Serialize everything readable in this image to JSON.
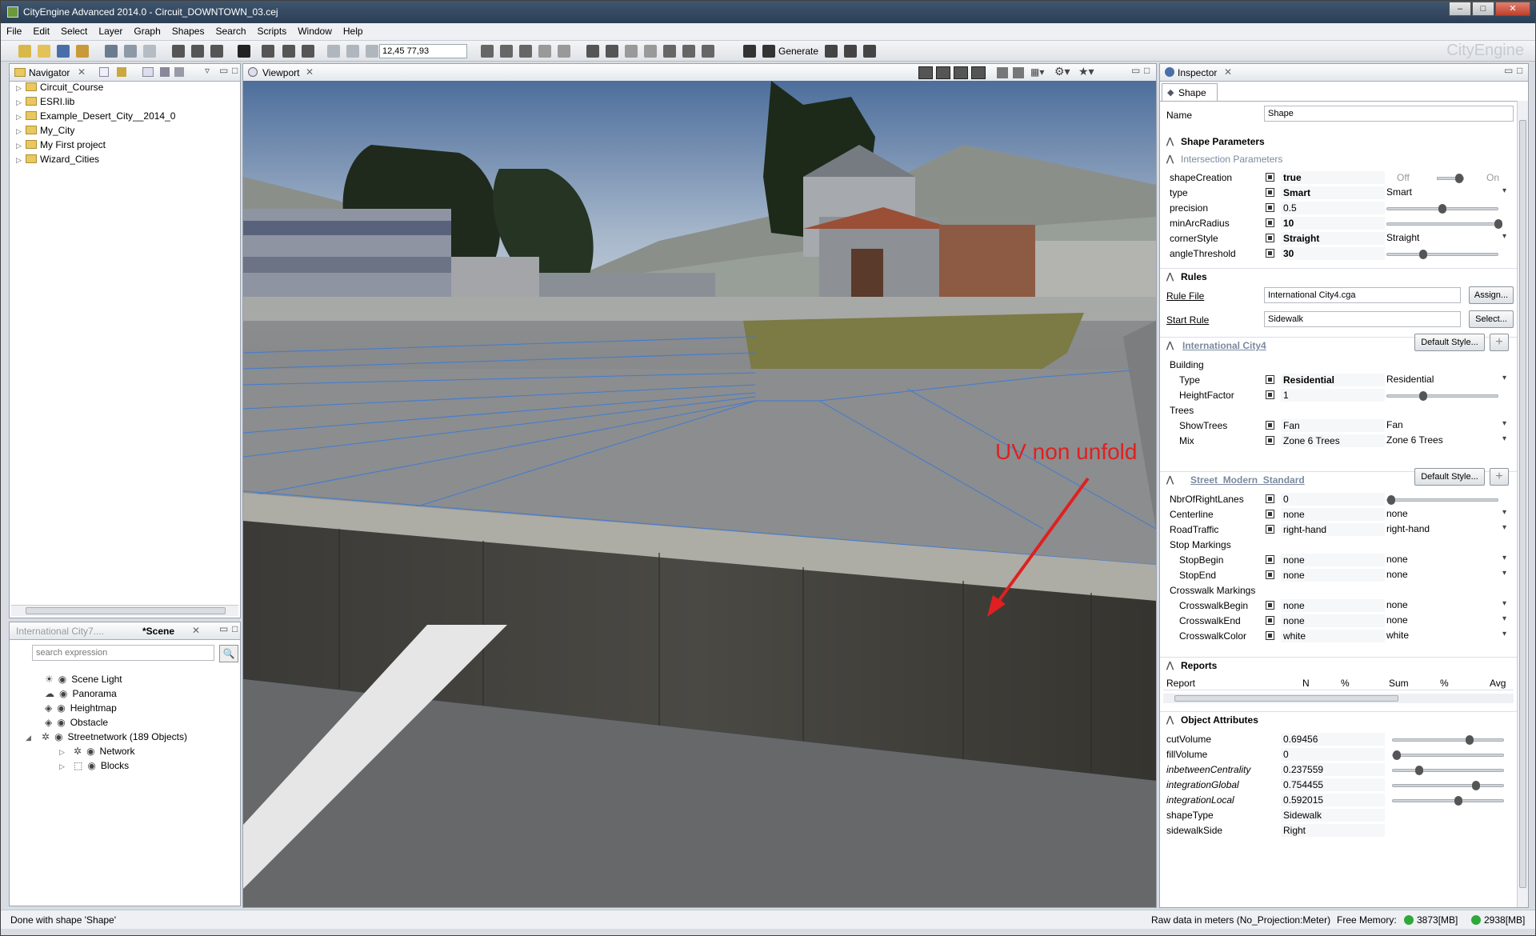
{
  "window": {
    "title": "CityEngine Advanced 2014.0 - Circuit_DOWNTOWN_03.cej"
  },
  "menu": [
    "File",
    "Edit",
    "Select",
    "Layer",
    "Graph",
    "Shapes",
    "Search",
    "Scripts",
    "Window",
    "Help"
  ],
  "toolbar": {
    "coord_value": "12,45 77,93",
    "generate_label": "Generate",
    "brand": "CityEngine"
  },
  "navigator": {
    "tab_label": "Navigator",
    "items": [
      "Circuit_Course",
      "ESRI.lib",
      "Example_Desert_City__2014_0",
      "My_City",
      "My First project",
      "Wizard_Cities"
    ]
  },
  "scene": {
    "tab_inactive": "International City7....",
    "tab_active": "*Scene",
    "search_placeholder": "search expression",
    "layers": [
      "Scene Light",
      "Panorama",
      "Heightmap",
      "Obstacle",
      "Streetnetwork (189 Objects)",
      "Network",
      "Blocks"
    ]
  },
  "viewport": {
    "tab_label": "Viewport",
    "annotation": "UV non unfold"
  },
  "inspector": {
    "tab_label": "Inspector",
    "subtab": "Shape",
    "name_label": "Name",
    "name_value": "Shape",
    "shape_parameters": "Shape Parameters",
    "intersection_parameters": "Intersection Parameters",
    "params": [
      {
        "label": "shapeCreation",
        "value": "true",
        "off": "Off",
        "on": "On"
      },
      {
        "label": "type",
        "value": "Smart",
        "choice": "Smart"
      },
      {
        "label": "precision",
        "value": "0.5",
        "slider": 0.5
      },
      {
        "label": "minArcRadius",
        "value": "10",
        "slider": 1.0
      },
      {
        "label": "cornerStyle",
        "value": "Straight",
        "choice": "Straight"
      },
      {
        "label": "angleThreshold",
        "value": "30",
        "slider": 0.33
      }
    ],
    "rules": {
      "title": "Rules",
      "rule_file_label": "Rule File",
      "rule_file_value": "International City4.cga",
      "assign": "Assign...",
      "start_rule_label": "Start Rule",
      "start_rule_value": "Sidewalk",
      "select": "Select..."
    },
    "city4": {
      "title": "International City4",
      "default_style": "Default Style...",
      "building": "Building",
      "type_label": "Type",
      "type_value": "Residential",
      "type_choice": "Residential",
      "height_label": "HeightFactor",
      "height_value": "1",
      "height_slider": 0.33,
      "trees": "Trees",
      "showtrees_label": "ShowTrees",
      "showtrees_value": "Fan",
      "showtrees_choice": "Fan",
      "mix_label": "Mix",
      "mix_value": "Zone 6 Trees",
      "mix_choice": "Zone 6 Trees"
    },
    "street": {
      "title": "Street_Modern_Standard",
      "default_style": "Default Style...",
      "rightlanes_label": "NbrOfRightLanes",
      "rightlanes_value": "0",
      "rightlanes_slider": 0.0,
      "centerline_label": "Centerline",
      "centerline_value": "none",
      "centerline_choice": "none",
      "traffic_label": "RoadTraffic",
      "traffic_value": "right-hand",
      "traffic_choice": "right-hand",
      "stop_markings": "Stop Markings",
      "stopbegin_label": "StopBegin",
      "stopbegin_value": "none",
      "stopbegin_choice": "none",
      "stopend_label": "StopEnd",
      "stopend_value": "none",
      "stopend_choice": "none",
      "crosswalk_markings": "Crosswalk Markings",
      "cwbegin_label": "CrosswalkBegin",
      "cwbegin_value": "none",
      "cwbegin_choice": "none",
      "cwend_label": "CrosswalkEnd",
      "cwend_value": "none",
      "cwend_choice": "none",
      "cwcolor_label": "CrosswalkColor",
      "cwcolor_value": "white",
      "cwcolor_choice": "white"
    },
    "reports": {
      "title": "Reports",
      "columns": [
        "Report",
        "N",
        "%",
        "Sum",
        "%",
        "Avg"
      ]
    },
    "object_attributes": {
      "title": "Object Attributes",
      "rows": [
        {
          "label": "cutVolume",
          "value": "0.69456",
          "slider": 0.69,
          "italic": false
        },
        {
          "label": "fillVolume",
          "value": "0",
          "slider": 0.0,
          "italic": false
        },
        {
          "label": "inbetweenCentrality",
          "value": "0.237559",
          "slider": 0.24,
          "italic": true
        },
        {
          "label": "integrationGlobal",
          "value": "0.754455",
          "slider": 0.75,
          "italic": true
        },
        {
          "label": "integrationLocal",
          "value": "0.592015",
          "slider": 0.59,
          "italic": true
        },
        {
          "label": "shapeType",
          "value": "Sidewalk",
          "italic": false
        },
        {
          "label": "sidewalkSide",
          "value": "Right",
          "italic": false
        }
      ]
    }
  },
  "status": {
    "left": "Done with shape 'Shape'",
    "projection": "Raw data in meters (No_Projection:Meter)",
    "memory_label": "Free Memory:",
    "mem1": "3873[MB]",
    "mem2": "2938[MB]"
  }
}
